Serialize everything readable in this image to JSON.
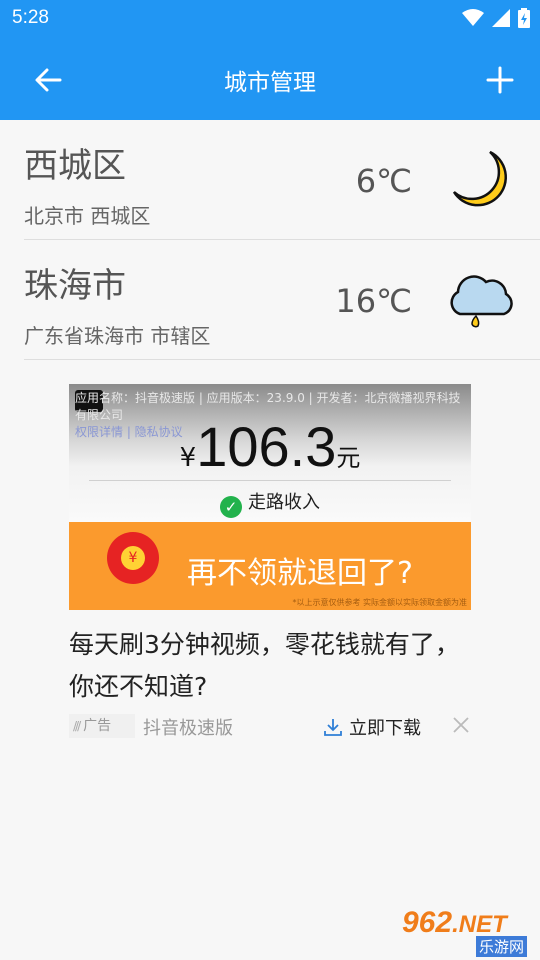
{
  "status_bar": {
    "time": "5:28"
  },
  "app_bar": {
    "title": "城市管理"
  },
  "cities": [
    {
      "name": "西城区",
      "region": "北京市 西城区",
      "temp": "6℃",
      "weather_icon": "moon-icon"
    },
    {
      "name": "珠海市",
      "region": "广东省珠海市 市辖区",
      "temp": "16℃",
      "weather_icon": "cloud-rain-icon"
    }
  ],
  "ad": {
    "meta": "应用名称：抖音极速版 | 应用版本：23.9.0 | 开发者：北京微播视界科技有限公司",
    "links": "权限详情 | 隐私协议",
    "currency": "¥",
    "amount": "106.3",
    "unit": "元",
    "walk_text": "走路收入",
    "slogan": "再不领就退回了?",
    "fine_print": "*以上示意仅供参考 实际金额以实际领取金额为准",
    "headline": "每天刷3分钟视频，零花钱就有了，你还不知道?",
    "tag": "广告",
    "source": "抖音极速版",
    "download": "立即下载"
  },
  "watermark": {
    "logo": "962",
    "suffix": ".NET",
    "sub": "乐游网"
  },
  "colors": {
    "primary": "#2196f3",
    "ad_orange": "#fb9a2d",
    "check_green": "#22b24c"
  }
}
